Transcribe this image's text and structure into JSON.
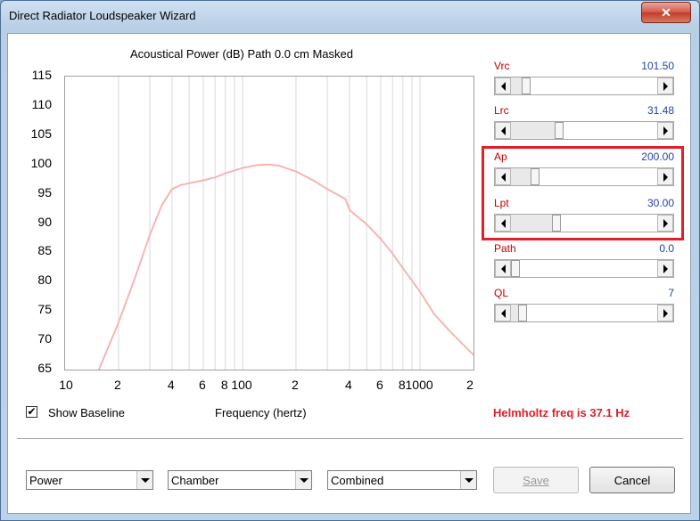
{
  "window": {
    "title": "Direct Radiator Loudspeaker Wizard",
    "close_symbol": "✕"
  },
  "chart_header": "Acoustical Power (dB)   Path 0.0 cm   Masked",
  "chart_data": {
    "type": "line",
    "title": "Acoustical Power (dB)   Path 0.0 cm   Masked",
    "xlabel": "Frequency (hertz)",
    "ylabel": "",
    "x_scale": "log",
    "xlim": [
      10,
      2000
    ],
    "ylim": [
      65,
      115
    ],
    "y_ticks": [
      "115",
      "110",
      "105",
      "100",
      "95",
      "90",
      "85",
      "80",
      "75",
      "70",
      "65"
    ],
    "x_ticks": [
      "10",
      "2",
      "4",
      "6",
      "8",
      "100",
      "2",
      "4",
      "6",
      "8",
      "1000",
      "2"
    ],
    "grid": true,
    "series": [
      {
        "color": "#f4b6b2",
        "x": [
          15.5,
          20,
          25,
          30,
          35,
          40,
          45,
          50,
          60,
          70,
          80,
          100,
          120,
          140,
          160,
          200,
          250,
          300,
          350,
          380,
          400,
          420,
          500,
          600,
          700,
          800,
          1000,
          1200,
          1500,
          2000
        ],
        "y": [
          65,
          73,
          81,
          88,
          93,
          95.8,
          96.5,
          96.8,
          97.3,
          97.8,
          98.5,
          99.4,
          99.9,
          100,
          99.8,
          98.8,
          97.3,
          95.8,
          94.7,
          94.1,
          92.3,
          91.7,
          89.8,
          87.3,
          84.8,
          82.3,
          78.3,
          74.5,
          71.3,
          67.5
        ]
      }
    ]
  },
  "params": [
    {
      "label": "Vrc",
      "value": "101.50",
      "fraction": 0.08
    },
    {
      "label": "Lrc",
      "value": "31.48",
      "fraction": 0.32
    },
    {
      "label": "Ap",
      "value": "200.00",
      "fraction": 0.14
    },
    {
      "label": "Lpt",
      "value": "30.00",
      "fraction": 0.3
    },
    {
      "label": "Path",
      "value": "0.0",
      "fraction": 0.0
    },
    {
      "label": "QL",
      "value": "7",
      "fraction": 0.05
    }
  ],
  "show_baseline": {
    "label": "Show Baseline",
    "checked": true,
    "check_glyph": "✔"
  },
  "xaxis_label": "Frequency (hertz)",
  "helmholtz": "Helmholtz freq is 37.1 Hz",
  "dropdowns": [
    {
      "value": "Power"
    },
    {
      "value": "Chamber"
    },
    {
      "value": "Combined"
    }
  ],
  "buttons": {
    "save": "Save",
    "cancel": "Cancel"
  },
  "colors": {
    "curve": "#f4b6b2",
    "highlight": "#e0202a",
    "param_label": "#c00000",
    "param_value": "#2244aa"
  }
}
